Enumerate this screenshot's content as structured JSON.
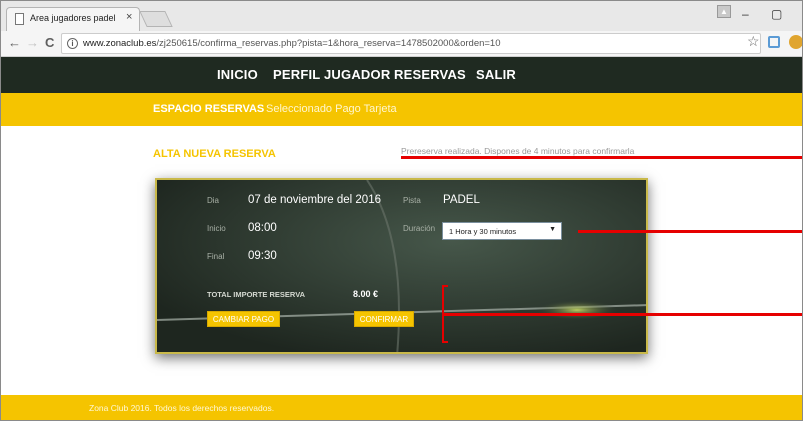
{
  "browser": {
    "tab_title": "Area jugadores padel",
    "tab_close": "×",
    "url_host": "www.zonaclub.es",
    "url_path": "/zj250615/confirma_reservas.php?pista=1&hora_reserva=1478502000&orden=10",
    "info_glyph": "i",
    "back_glyph": "←",
    "forward_glyph": "→",
    "reload_glyph": "C",
    "star_glyph": "☆",
    "minimize_glyph": "–",
    "maximize_glyph": "▢",
    "user_glyph": "▲"
  },
  "site_nav": [
    "INICIO",
    "PERFIL JUGADOR",
    "RESERVAS",
    "SALIR"
  ],
  "sub_nav": {
    "active": "ESPACIO RESERVAS",
    "secondary": "Seleccionado Pago Tarjeta"
  },
  "section_title": "ALTA NUEVA RESERVA",
  "prereserva_msg": "Prereserva realizada. Dispones de 4 minutos para confirmarla",
  "reserva": {
    "dia_label": "Dia",
    "dia_value": "07 de noviembre del 2016",
    "inicio_label": "Inicio",
    "inicio_value": "08:00",
    "final_label": "Final",
    "final_value": "09:30",
    "pista_label": "Pista",
    "pista_value": "PADEL",
    "duracion_label": "Duración",
    "duracion_value": "1 Hora y 30 minutos",
    "duracion_arrow": "▼",
    "total_label": "TOTAL IMPORTE RESERVA",
    "total_value": "8.00 €",
    "cambiar_pago": "CAMBIAR PAGO",
    "confirmar": "CONFIRMAR"
  },
  "footer_text": "Zona Club 2016. Todos los derechos reservados.",
  "colors": {
    "accent_yellow": "#f5c400",
    "nav_dark": "#1f2a21",
    "annotation_red": "#e60000"
  }
}
